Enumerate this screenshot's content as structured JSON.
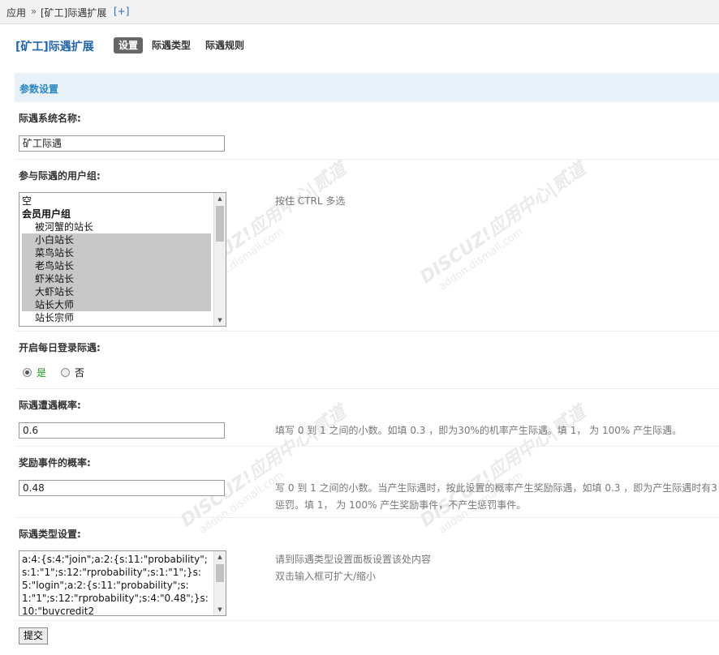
{
  "breadcrumb": {
    "app": "应用",
    "sep": "»",
    "current": "[矿工]际遇扩展",
    "add": "[+]"
  },
  "page_title": "[矿工]际遇扩展",
  "tabs": [
    "设置",
    "际遇类型",
    "际遇规则"
  ],
  "section_title": "参数设置",
  "fields": {
    "system_name": {
      "label": "际遇系统名称:",
      "value": "矿工际遇"
    },
    "user_groups": {
      "label": "参与际遇的用户组:",
      "help": "按住 CTRL 多选",
      "options": [
        {
          "text": "空",
          "selected": false,
          "group": false
        },
        {
          "text": "会员用户组",
          "selected": false,
          "group": true
        },
        {
          "text": "被河蟹的站长",
          "selected": false,
          "group": false
        },
        {
          "text": "小白站长",
          "selected": true,
          "group": false
        },
        {
          "text": "菜鸟站长",
          "selected": true,
          "group": false
        },
        {
          "text": "老鸟站长",
          "selected": true,
          "group": false
        },
        {
          "text": "虾米站长",
          "selected": true,
          "group": false
        },
        {
          "text": "大虾站长",
          "selected": true,
          "group": false
        },
        {
          "text": "站长大师",
          "selected": true,
          "group": false
        },
        {
          "text": "站长宗师",
          "selected": false,
          "group": false
        }
      ]
    },
    "daily_login": {
      "label": "开启每日登录际遇:",
      "yes": "是",
      "no": "否",
      "selected": "yes"
    },
    "probability": {
      "label": "际遇遭遇概率:",
      "value": "0.6",
      "help": "填写 0 到 1 之间的小数。如填 0.3 ，即为30%的机率产生际遇。填 1， 为 100% 产生际遇。"
    },
    "reward_probability": {
      "label": "奖励事件的概率:",
      "value": "0.48",
      "help_line1": "写 0 到 1 之间的小数。当产生际遇时，按此设置的概率产生奖励际遇，如填 0.3 ，即为产生际遇时有3",
      "help_line2": "惩罚。填 1， 为 100% 产生奖励事件，不产生惩罚事件。"
    },
    "type_settings": {
      "label": "际遇类型设置:",
      "value": "a:4:{s:4:\"join\";a:2:{s:11:\"probability\";s:1:\"1\";s:12:\"rprobability\";s:1:\"1\";}s:5:\"login\";a:2:{s:11:\"probability\";s:1:\"1\";s:12:\"rprobability\";s:4:\"0.48\";}s:10:\"buycredit2",
      "help_line1": "请到际遇类型设置面板设置该处内容",
      "help_line2": "双击输入框可扩大/缩小"
    }
  },
  "submit_label": "提交",
  "watermark": {
    "brand": "DISCUZ!应用中心|贰道",
    "url": "addon.dismall.com"
  },
  "colors": {
    "title": "#2366a8",
    "section_bg": "#e8f1f8",
    "section_text": "#2b87c0",
    "selected_option": "#c8c8c8"
  }
}
